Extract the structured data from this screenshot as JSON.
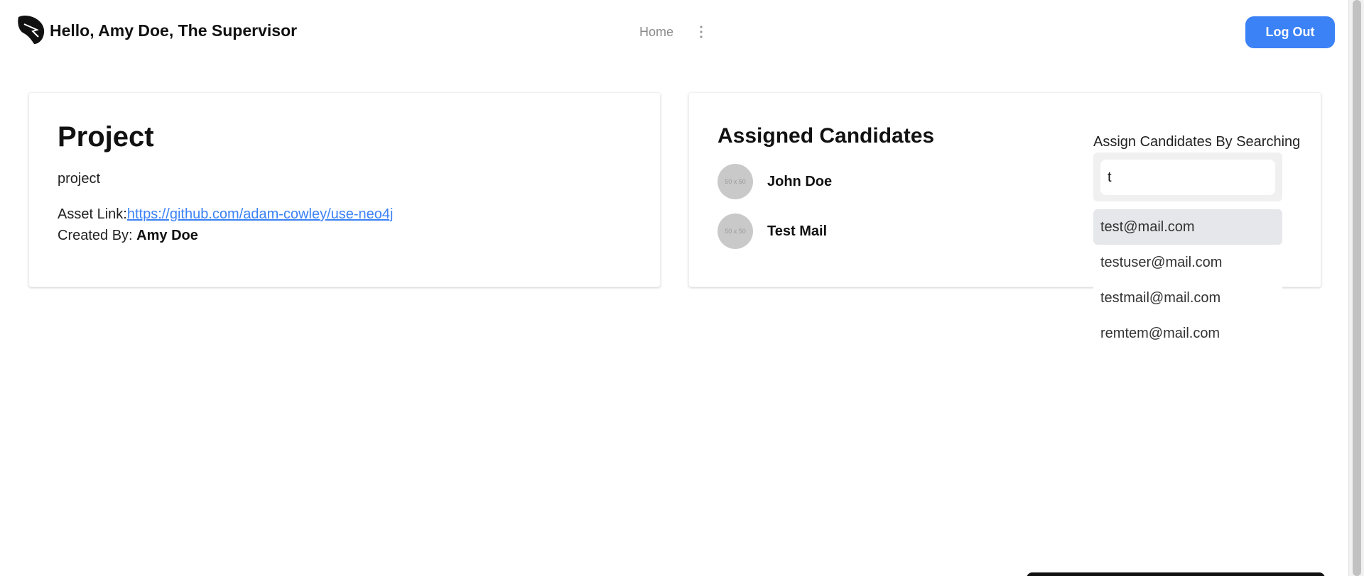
{
  "header": {
    "greeting": "Hello, Amy Doe, The Supervisor",
    "logo_icon": "bird-leaf-logo-icon",
    "nav_home": "Home",
    "more_icon": "vertical-ellipsis-icon",
    "logout_label": "Log Out"
  },
  "project": {
    "title": "Project",
    "description": "project",
    "asset_label": "Asset Link:",
    "asset_url": "https://github.com/adam-cowley/use-neo4j",
    "created_label": "Created By: ",
    "created_by": "Amy Doe"
  },
  "assigned": {
    "title": "Assigned Candidates",
    "candidates": [
      {
        "name": "John Doe",
        "avatar_text": "50 x 50"
      },
      {
        "name": "Test Mail",
        "avatar_text": "50 x 50"
      }
    ]
  },
  "search": {
    "label": "Assign Candidates By Searching",
    "value": "t",
    "results": [
      "test@mail.com",
      "testuser@mail.com",
      "testmail@mail.com",
      "remtem@mail.com"
    ]
  },
  "colors": {
    "accent": "#3b82f6",
    "highlight": "#e6e7ea"
  }
}
